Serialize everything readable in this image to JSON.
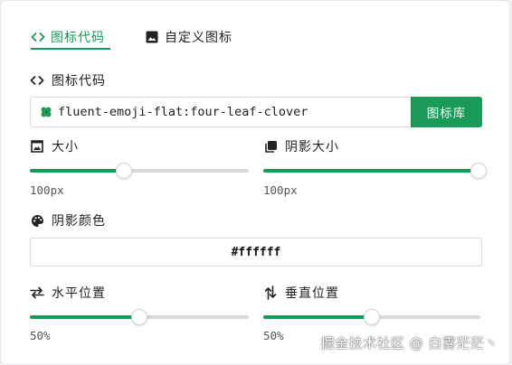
{
  "tabs": [
    {
      "label": "图标代码",
      "icon": "code-icon",
      "active": true
    },
    {
      "label": "自定义图标",
      "icon": "image-icon",
      "active": false
    }
  ],
  "icon_code": {
    "label": "图标代码",
    "value": "fluent-emoji-flat:four-leaf-clover",
    "library_button": "图标库"
  },
  "size": {
    "label": "大小",
    "value_text": "100px",
    "fraction": 0.43
  },
  "shadow_size": {
    "label": "阴影大小",
    "value_text": "100px",
    "fraction": 0.99
  },
  "shadow_color": {
    "label": "阴影颜色",
    "value": "#ffffff"
  },
  "horizontal": {
    "label": "水平位置",
    "value_text": "50%",
    "fraction": 0.5
  },
  "vertical": {
    "label": "垂直位置",
    "value_text": "50%",
    "fraction": 0.5
  },
  "watermark": "掘金技术社区 @ 白雾茫茫丶",
  "colors": {
    "accent": "#1a9a57",
    "track": "#d9d9d9"
  }
}
